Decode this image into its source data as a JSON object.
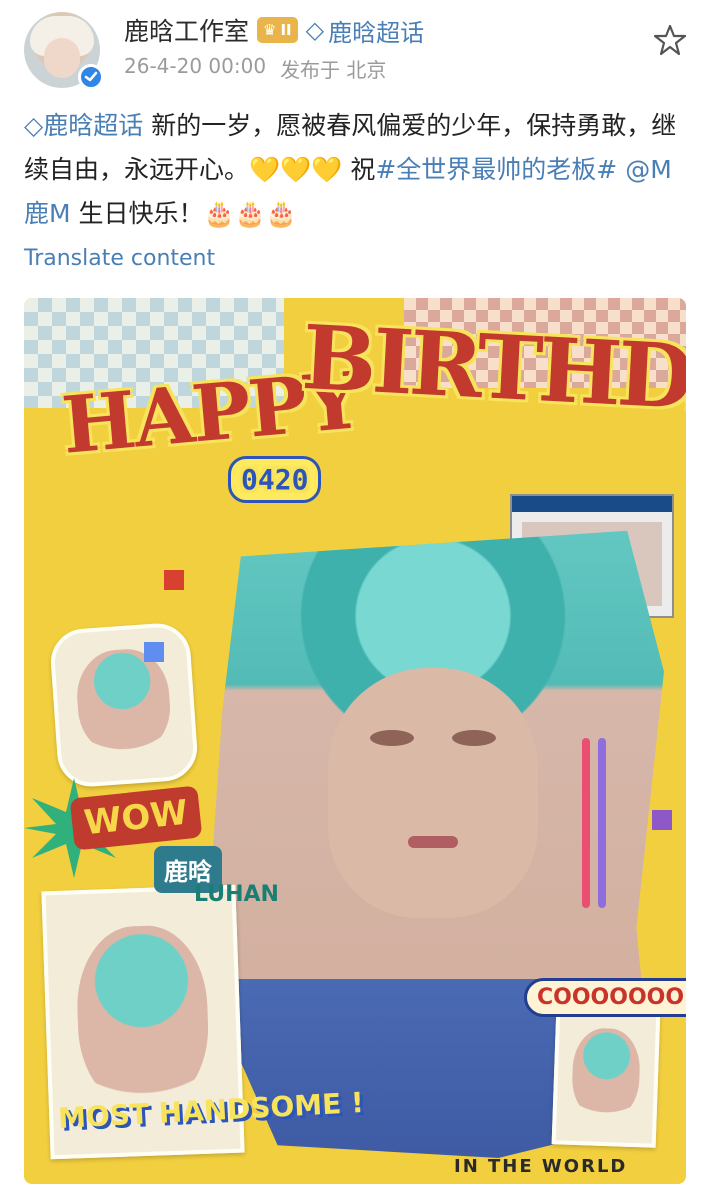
{
  "post": {
    "author": "鹿晗工作室",
    "level_badge": "II",
    "topic": "鹿晗超话",
    "timestamp": "26-4-20 00:00",
    "location": "发布于 北京",
    "content": {
      "topic": "鹿晗超话",
      "text1": " 新的一岁，愿被春风偏爱的少年，保持勇敢，继续自由，永远开心。💛💛💛 祝",
      "hashtag": "#全世界最帅的老板#",
      "text2": " ",
      "mention": "@M鹿M",
      "text3": " 生日快乐！🎂🎂🎂"
    },
    "translate": "Translate content"
  },
  "poster": {
    "happy": "HAPPY",
    "birthday": "BIRTHDAY",
    "date": "0420",
    "wow": "WOW",
    "name_cn": "鹿晗",
    "name_en": "LUHAN",
    "cool": "COOOOOOOL",
    "most_handsome": "MOST HANDSOME !",
    "world": "IN THE WORLD"
  },
  "icons": {
    "verify": "verify-icon",
    "star": "star-icon",
    "crown": "crown-icon",
    "diamond": "diamond-icon"
  },
  "colors": {
    "link": "#4a7fb6",
    "poster_background": "#f2cf3f",
    "headline": "#c2392d"
  }
}
